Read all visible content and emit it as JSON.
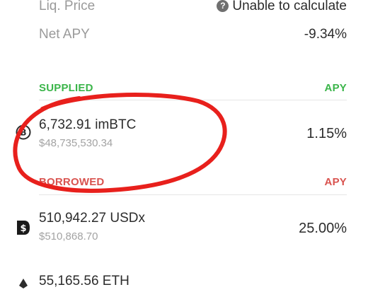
{
  "summary": {
    "liq_price_label": "Liq. Price",
    "liq_price_value": "Unable to calculate",
    "net_apy_label": "Net APY",
    "net_apy_value": "-9.34%"
  },
  "supplied": {
    "heading": "SUPPLIED",
    "apy_heading": "APY",
    "accent_color": "#3bb54a",
    "items": [
      {
        "amount": "6,732.91 imBTC",
        "usd": "$48,735,530.34",
        "apy": "1.15%",
        "icon": "bitcoin-icon"
      }
    ]
  },
  "borrowed": {
    "heading": "BORROWED",
    "apy_heading": "APY",
    "accent_color": "#d9534f",
    "items": [
      {
        "amount": "510,942.27 USDx",
        "usd": "$510,868.70",
        "apy": "25.00%",
        "icon": "usdx-icon"
      },
      {
        "amount": "55,165.56 ETH",
        "icon": "ethereum-icon"
      }
    ]
  },
  "annotation": {
    "color": "#e8201c",
    "shape": "hand-drawn-circle"
  },
  "icons": {
    "help": "?"
  }
}
